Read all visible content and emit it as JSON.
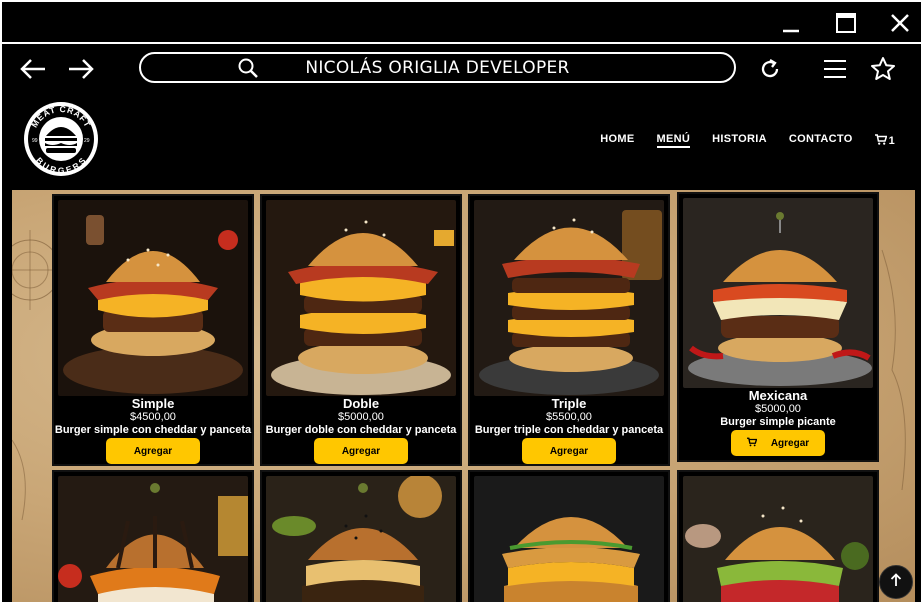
{
  "window": {
    "minimize_icon": "minimize-icon",
    "maximize_icon": "maximize-icon",
    "close_icon": "close-icon"
  },
  "browser": {
    "url": "NICOLÁS ORIGLIA DEVELOPER",
    "back_icon": "arrow-left-icon",
    "forward_icon": "arrow-right-icon",
    "search_icon": "search-icon",
    "reload_icon": "reload-icon",
    "menu_icon": "hamburger-menu-icon",
    "bookmark_icon": "star-icon"
  },
  "site": {
    "logo": {
      "top": "MEAT CRAFT",
      "bottom": "BURGERS",
      "left_num": "99",
      "right_num": "29"
    },
    "nav": [
      {
        "label": "HOME"
      },
      {
        "label": "MENÚ",
        "active": true
      },
      {
        "label": "HISTORIA"
      },
      {
        "label": "CONTACTO"
      }
    ],
    "cart_count": "1"
  },
  "products": [
    {
      "name": "Simple",
      "price": "$4500,00",
      "description": "Burger simple con cheddar y panceta",
      "button": "Agregar"
    },
    {
      "name": "Doble",
      "price": "$5000,00",
      "description": "Burger doble con cheddar y panceta",
      "button": "Agregar"
    },
    {
      "name": "Triple",
      "price": "$5500,00",
      "description": "Burger triple con cheddar y panceta",
      "button": "Agregar"
    },
    {
      "name": "Mexicana",
      "price": "$5000,00",
      "description": "Burger simple picante",
      "button": "Agregar"
    }
  ],
  "colors": {
    "accent": "#ffc700",
    "background": "#000000",
    "text": "#ffffff"
  }
}
